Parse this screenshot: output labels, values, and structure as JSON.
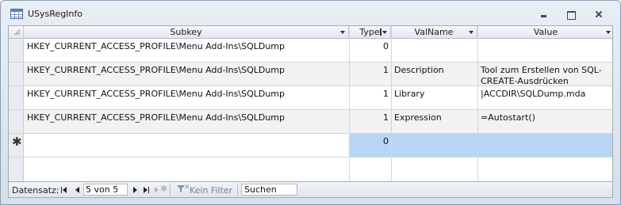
{
  "window": {
    "title": "USysRegInfo"
  },
  "columns": [
    {
      "key": "subkey",
      "label": "Subkey"
    },
    {
      "key": "type",
      "label": "Type"
    },
    {
      "key": "valname",
      "label": "ValName"
    },
    {
      "key": "value",
      "label": "Value"
    }
  ],
  "rows": [
    {
      "subkey": "HKEY_CURRENT_ACCESS_PROFILE\\Menu Add-Ins\\SQLDump",
      "type": "0",
      "valname": "",
      "value": ""
    },
    {
      "subkey": "HKEY_CURRENT_ACCESS_PROFILE\\Menu Add-Ins\\SQLDump",
      "type": "1",
      "valname": "Description",
      "value": "Tool zum Erstellen von SQL-CREATE-Ausdrücken"
    },
    {
      "subkey": "HKEY_CURRENT_ACCESS_PROFILE\\Menu Add-Ins\\SQLDump",
      "type": "1",
      "valname": "Library",
      "value": "|ACCDIR\\SQLDump.mda"
    },
    {
      "subkey": "HKEY_CURRENT_ACCESS_PROFILE\\Menu Add-Ins\\SQLDump",
      "type": "1",
      "valname": "Expression",
      "value": "=Autostart()"
    }
  ],
  "new_row": {
    "marker": "✱",
    "type": "0"
  },
  "navigation": {
    "label": "Datensatz:",
    "record": "5 von 5",
    "filter_label": "Kein Filter",
    "search_label": "Suchen"
  },
  "colors": {
    "selected_cell": "#b9d5f4",
    "alt_row": "#f2f2f2",
    "frame": "#d6dfea"
  },
  "icons": [
    "table-icon",
    "minimize-icon",
    "restore-icon",
    "close-icon",
    "sort-filter-icon",
    "first-record-icon",
    "prev-record-icon",
    "next-record-icon",
    "last-record-icon",
    "new-record-icon",
    "no-filter-icon"
  ]
}
